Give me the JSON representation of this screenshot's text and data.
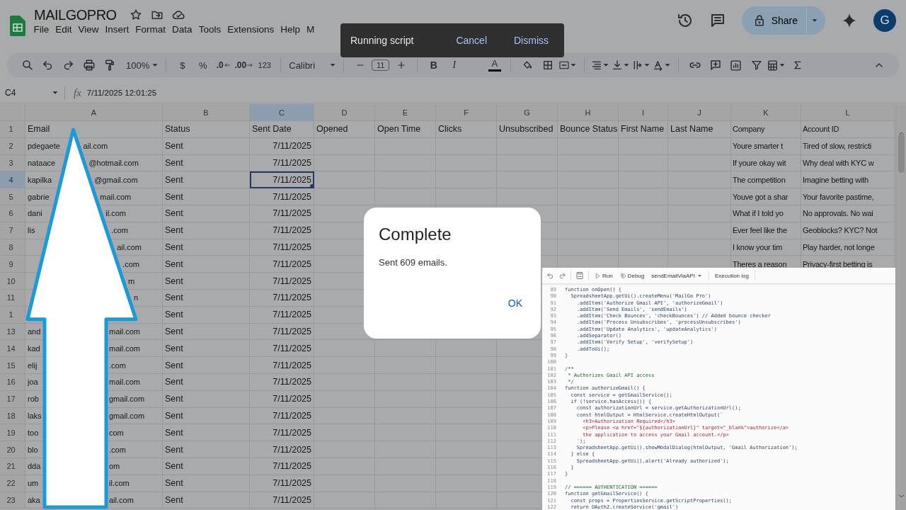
{
  "app": {
    "title": "MAILGOPRO",
    "menu": [
      "File",
      "Edit",
      "View",
      "Insert",
      "Format",
      "Data",
      "Tools",
      "Extensions",
      "Help",
      "M"
    ],
    "share": "Share",
    "avatar": "G"
  },
  "toolbar": {
    "zoom": "100%",
    "currency": "$",
    "percent": "%",
    "decrease_decimal": ".0",
    "increase_decimal": ".00",
    "number_format": "123",
    "font": "Calibri",
    "font_size": "11",
    "bold": "B",
    "italic": "I",
    "text_color": "A"
  },
  "formula_bar": {
    "cell": "C4",
    "label": "fx",
    "value": "7/11/2025 12:01:25"
  },
  "sheet": {
    "columns": [
      {
        "letter": "A",
        "selected": false
      },
      {
        "letter": "B",
        "selected": false
      },
      {
        "letter": "C",
        "selected": true
      },
      {
        "letter": "D",
        "selected": false
      },
      {
        "letter": "E",
        "selected": false
      },
      {
        "letter": "F",
        "selected": false
      },
      {
        "letter": "G",
        "selected": false
      },
      {
        "letter": "H",
        "selected": false
      },
      {
        "letter": "I",
        "selected": false
      },
      {
        "letter": "J",
        "selected": false
      },
      {
        "letter": "K",
        "selected": false
      },
      {
        "letter": "L",
        "selected": false
      }
    ],
    "header": {
      "number": "1",
      "cells": [
        "Email",
        "Status",
        "Sent Date",
        "Opened",
        "Open Time",
        "Clicks",
        "Unsubscribed",
        "Bounce Status",
        "First Name",
        "Last Name",
        "Company",
        "Account ID"
      ]
    },
    "rows": [
      {
        "number": "2",
        "selected": false,
        "email_start": "pdegaete",
        "email_end": "ail.com",
        "status": "Sent",
        "sent_date": "7/11/2025",
        "company": "Youre smarter t",
        "account_id": "Tired of slow, restricti"
      },
      {
        "number": "3",
        "selected": false,
        "email_start": "nataace",
        "email_end": "@hotmail.com",
        "status": "Sent",
        "sent_date": "7/11/2025",
        "company": "If youre okay wit",
        "account_id": "Why deal with KYC w"
      },
      {
        "number": "4",
        "selected": true,
        "email_start": "kapilka",
        "email_end": "@gmail.com",
        "status": "Sent",
        "sent_date": "7/11/2025",
        "company": "The competition",
        "account_id": "Imagine betting with"
      },
      {
        "number": "5",
        "selected": false,
        "email_start": "gabrie",
        "email_end": "mail.com",
        "status": "Sent",
        "sent_date": "7/11/2025",
        "company": "Youve got a shar",
        "account_id": "Your favorite pastime,"
      },
      {
        "number": "6",
        "selected": false,
        "email_start": "dani",
        "email_end": "il.com",
        "status": "Sent",
        "sent_date": "7/11/2025",
        "company": "What if I told yo",
        "account_id": "No approvals. No wai"
      },
      {
        "number": "7",
        "selected": false,
        "email_start": "lis",
        "email_end": ".com",
        "status": "Sent",
        "sent_date": "7/11/2025",
        "company": "Ever feel like the",
        "account_id": "Geoblocks? KYC? Not"
      },
      {
        "number": "8",
        "selected": false,
        "email_end": "ail.com",
        "status": "Sent",
        "sent_date": "7/11/2025",
        "company": "I know your tim",
        "account_id": "Play harder, not longe"
      },
      {
        "number": "9",
        "selected": false,
        "email_end": ".com",
        "status": "Sent",
        "sent_date": "7/11/2025",
        "company": "Theres a reason",
        "account_id": "Privacy-first betting is"
      },
      {
        "number": "10",
        "selected": false,
        "email_end": "m",
        "status": "Sent",
        "sent_date": "7/11/2025"
      },
      {
        "number": "11",
        "selected": false,
        "email_end": "n",
        "status": "Sent",
        "sent_date": "7/11/2025"
      },
      {
        "number": "1",
        "selected": false,
        "status": "Sent",
        "sent_date": "7/11/2025"
      },
      {
        "number": "13",
        "selected": false,
        "email_start": "and",
        "email_end": "mail.com",
        "status": "Sent",
        "sent_date": "7/11/2025"
      },
      {
        "number": "14",
        "selected": false,
        "email_start": "kad",
        "email_end": "mail.com",
        "status": "Sent",
        "sent_date": "7/11/2025"
      },
      {
        "number": "15",
        "selected": false,
        "email_start": "elij",
        "email_end": ".com",
        "status": "Sent",
        "sent_date": "7/11/2025"
      },
      {
        "number": "16",
        "selected": false,
        "email_start": "joa",
        "email_end": "mail.com",
        "status": "Sent",
        "sent_date": "7/11/2025"
      },
      {
        "number": "17",
        "selected": false,
        "email_start": "rob",
        "email_end": "gmail.com",
        "status": "Sent",
        "sent_date": "7/11/2025"
      },
      {
        "number": "18",
        "selected": false,
        "email_start": "laks",
        "email_end": "gmail.com",
        "status": "Sent",
        "sent_date": "7/11/2025"
      },
      {
        "number": "19",
        "selected": false,
        "email_start": "too",
        "email_end": "com",
        "status": "Sent",
        "sent_date": "7/11/2025"
      },
      {
        "number": "20",
        "selected": false,
        "email_start": "blo",
        "email_end": ".com",
        "status": "Sent",
        "sent_date": "7/11/2025"
      },
      {
        "number": "21",
        "selected": false,
        "email_start": "dda",
        "email_end": "om",
        "status": "Sent",
        "sent_date": "7/11/2025"
      },
      {
        "number": "22",
        "selected": false,
        "email_start": "um",
        "email_end": "il.com",
        "status": "Sent",
        "sent_date": "7/11/2025"
      },
      {
        "number": "23",
        "selected": false,
        "email_start": "aka",
        "email_end": "ail.com",
        "status": "Sent",
        "sent_date": "7/11/2025"
      }
    ]
  },
  "snackbar": {
    "message": "Running script",
    "actions": [
      "Cancel",
      "Dismiss"
    ]
  },
  "dialog": {
    "title": "Complete",
    "message": "Sent 609 emails.",
    "button": "OK"
  },
  "editor": {
    "run": "Run",
    "debug": "Debug",
    "function": "sendEmailViaAPI",
    "log": "Execution log",
    "lines": [
      {
        "number": "89",
        "kind": "code",
        "text": "function onOpen() {"
      },
      {
        "number": "90",
        "kind": "code",
        "text": "  SpreadsheetApp.getUi().createMenu('MailGo Pro')"
      },
      {
        "number": "91",
        "kind": "code",
        "text": "    .addItem('Authorize Gmail API', 'authorizeGmail')"
      },
      {
        "number": "92",
        "kind": "code",
        "text": "    .addItem('Send Emails', 'sendEmails')"
      },
      {
        "number": "93",
        "kind": "code",
        "text": "    .addItem('Check Bounces', 'checkBounces') // Added bounce checker"
      },
      {
        "number": "94",
        "kind": "code",
        "text": "    .addItem('Process Unsubscribes', 'processUnsubscribes')"
      },
      {
        "number": "95",
        "kind": "code",
        "text": "    .addItem('Update Analytics', 'updateAnalytics')"
      },
      {
        "number": "96",
        "kind": "code",
        "text": "    .addSeparator()"
      },
      {
        "number": "97",
        "kind": "code",
        "text": "    .addItem('Verify Setup', 'verifySetup')"
      },
      {
        "number": "98",
        "kind": "code",
        "text": "    .addToUi();"
      },
      {
        "number": "99",
        "kind": "code",
        "text": "}"
      },
      {
        "number": "100"
      },
      {
        "number": "101",
        "kind": "comment",
        "text": "/**"
      },
      {
        "number": "102",
        "kind": "comment",
        "text": " * Authorizes Gmail API access"
      },
      {
        "number": "103",
        "kind": "comment",
        "text": " */"
      },
      {
        "number": "104",
        "kind": "code",
        "text": "function authorizeGmail() {"
      },
      {
        "number": "105",
        "kind": "code",
        "text": "  const service = getGmailService();"
      },
      {
        "number": "106",
        "kind": "code",
        "text": "  if (!service.hasAccess()) {"
      },
      {
        "number": "107",
        "kind": "code",
        "text": "    const authorizationUrl = service.getAuthorizationUrl();"
      },
      {
        "number": "108",
        "kind": "code",
        "text": "    const htmlOutput = HtmlService.createHtmlOutput(`"
      },
      {
        "number": "109",
        "kind": "string",
        "text": "      <h3>Authorization Required</h3>"
      },
      {
        "number": "110",
        "kind": "string",
        "text": "      <p>Please <a href=\"${authorizationUrl}\" target=\"_blank\">authorize</a>"
      },
      {
        "number": "111",
        "kind": "string",
        "text": "      the application to access your Gmail account.</p>"
      },
      {
        "number": "112",
        "kind": "string",
        "text": "    `);"
      },
      {
        "number": "113",
        "kind": "code",
        "text": "    SpreadsheetApp.getUi().showModalDialog(htmlOutput, 'Gmail Authorization');"
      },
      {
        "number": "114",
        "kind": "code",
        "text": "  } else {"
      },
      {
        "number": "115",
        "kind": "code",
        "text": "    SpreadsheetApp.getUi().alert('Already authorized');"
      },
      {
        "number": "116",
        "kind": "code",
        "text": "  }"
      },
      {
        "number": "117",
        "kind": "code",
        "text": "}"
      },
      {
        "number": "118"
      },
      {
        "number": "119",
        "kind": "comment",
        "text": "// ====== AUTHENTICATION ======"
      },
      {
        "number": "120",
        "kind": "code",
        "text": "function getGmailService() {"
      },
      {
        "number": "121",
        "kind": "code",
        "text": "  const props = PropertiesService.getScriptProperties();"
      },
      {
        "number": "122",
        "kind": "code",
        "text": "  return OAuth2.createService('gmail')"
      }
    ]
  }
}
